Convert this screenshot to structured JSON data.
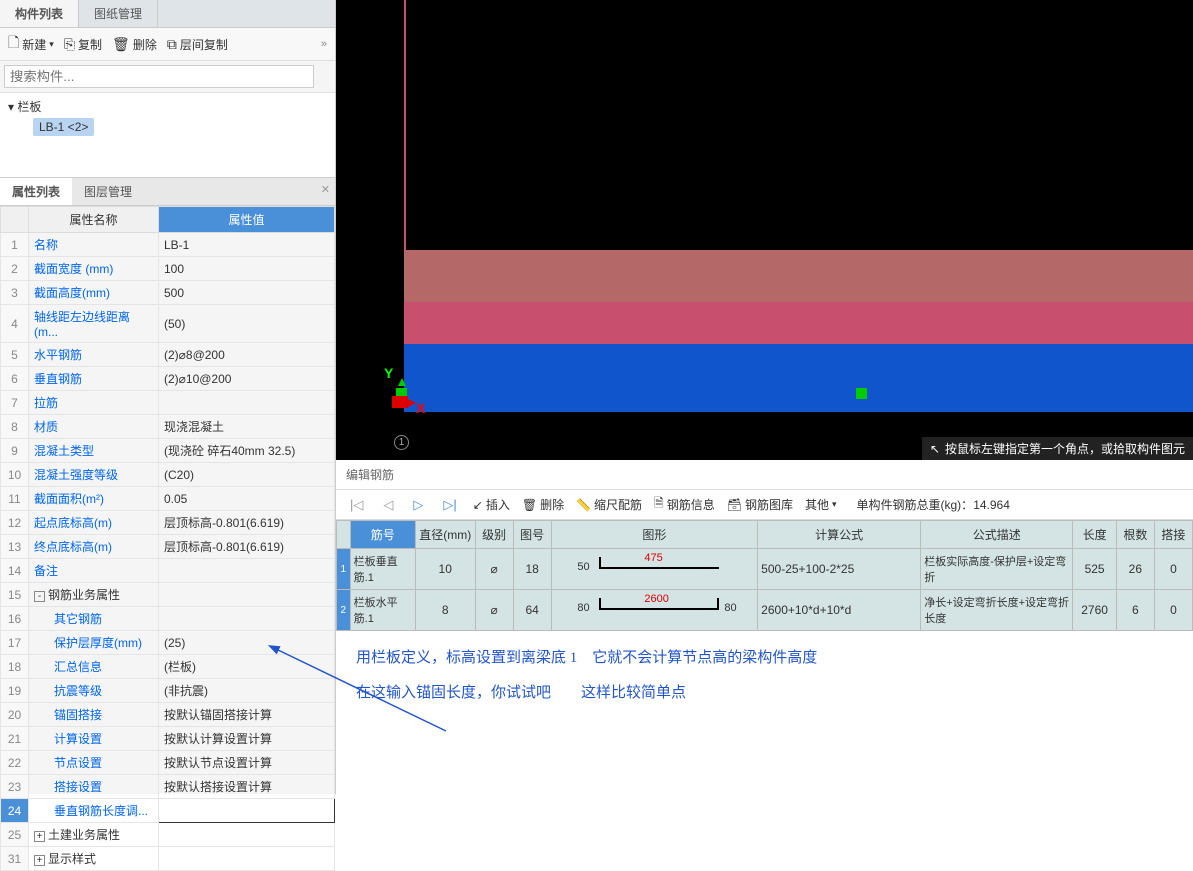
{
  "topTabs": {
    "active": "构件列表",
    "other": "图纸管理"
  },
  "toolbar": {
    "new": "新建",
    "copy": "复制",
    "delete": "删除",
    "levelCopy": "层间复制"
  },
  "search": {
    "placeholder": "搜索构件..."
  },
  "tree": {
    "root": "栏板",
    "item": "LB-1 <2>"
  },
  "propTabs": {
    "active": "属性列表",
    "other": "图层管理"
  },
  "propHeader": {
    "name": "属性名称",
    "value": "属性值"
  },
  "props": [
    {
      "n": "1",
      "name": "名称",
      "val": "LB-1",
      "blue": true
    },
    {
      "n": "2",
      "name": "截面宽度 (mm)",
      "val": "100",
      "blue": true
    },
    {
      "n": "3",
      "name": "截面高度(mm)",
      "val": "500",
      "blue": true
    },
    {
      "n": "4",
      "name": "轴线距左边线距离(m...",
      "val": "(50)",
      "blue": true
    },
    {
      "n": "5",
      "name": "水平钢筋",
      "val": "(2)⌀8@200",
      "blue": true
    },
    {
      "n": "6",
      "name": "垂直钢筋",
      "val": "(2)⌀10@200",
      "blue": true
    },
    {
      "n": "7",
      "name": "拉筋",
      "val": "",
      "blue": true
    },
    {
      "n": "8",
      "name": "材质",
      "val": "现浇混凝土",
      "blue": true
    },
    {
      "n": "9",
      "name": "混凝土类型",
      "val": "(现浇砼 碎石40mm 32.5)",
      "blue": true
    },
    {
      "n": "10",
      "name": "混凝土强度等级",
      "val": "(C20)",
      "blue": true
    },
    {
      "n": "11",
      "name": "截面面积(m²)",
      "val": "0.05",
      "blue": true
    },
    {
      "n": "12",
      "name": "起点底标高(m)",
      "val": "层顶标高-0.801(6.619)",
      "blue": true
    },
    {
      "n": "13",
      "name": "终点底标高(m)",
      "val": "层顶标高-0.801(6.619)",
      "blue": true
    },
    {
      "n": "14",
      "name": "备注",
      "val": "",
      "blue": true
    },
    {
      "n": "15",
      "name": "钢筋业务属性",
      "val": "",
      "exp": "-"
    },
    {
      "n": "16",
      "name": "其它钢筋",
      "val": "",
      "blue": true,
      "indent": true
    },
    {
      "n": "17",
      "name": "保护层厚度(mm)",
      "val": "(25)",
      "blue": true,
      "indent": true
    },
    {
      "n": "18",
      "name": "汇总信息",
      "val": "(栏板)",
      "blue": true,
      "indent": true
    },
    {
      "n": "19",
      "name": "抗震等级",
      "val": "(非抗震)",
      "blue": true,
      "indent": true
    },
    {
      "n": "20",
      "name": "锚固搭接",
      "val": "按默认锚固搭接计算",
      "blue": true,
      "indent": true
    },
    {
      "n": "21",
      "name": "计算设置",
      "val": "按默认计算设置计算",
      "blue": true,
      "indent": true
    },
    {
      "n": "22",
      "name": "节点设置",
      "val": "按默认节点设置计算",
      "blue": true,
      "indent": true
    },
    {
      "n": "23",
      "name": "搭接设置",
      "val": "按默认搭接设置计算",
      "blue": true,
      "indent": true
    },
    {
      "n": "24",
      "name": "垂直钢筋长度调...",
      "val": "",
      "blue": true,
      "indent": true,
      "highlight": true
    },
    {
      "n": "25",
      "name": "土建业务属性",
      "val": "",
      "exp": "+"
    },
    {
      "n": "31",
      "name": "显示样式",
      "val": "",
      "exp": "+"
    }
  ],
  "canvas": {
    "y": "Y",
    "x": "X",
    "num": "1"
  },
  "statusBar": "按鼠标左键指定第一个角点，或拾取构件图元",
  "rebarTitle": "编辑钢筋",
  "rebarToolbar": {
    "insert": "插入",
    "delete": "删除",
    "scale": "缩尺配筋",
    "info": "钢筋信息",
    "lib": "钢筋图库",
    "other": "其他",
    "weightLabel": "单构件钢筋总重(kg)：",
    "weight": "14.964"
  },
  "rebarHeader": {
    "num": "筋号",
    "dia": "直径(mm)",
    "grade": "级别",
    "symbol": "图号",
    "shape": "图形",
    "formula": "计算公式",
    "desc": "公式描述",
    "len": "长度",
    "count": "根数",
    "lap": "搭接"
  },
  "rebarRows": [
    {
      "rn": "1",
      "name": "栏板垂直筋.1",
      "dia": "10",
      "grade": "⌀",
      "sym": "18",
      "l": "50",
      "mid": "475",
      "r": "",
      "formula": "500-25+100-2*25",
      "desc": "栏板实际高度-保护层+设定弯折",
      "len": "525",
      "count": "26",
      "lap": "0"
    },
    {
      "rn": "2",
      "name": "栏板水平筋.1",
      "dia": "8",
      "grade": "⌀",
      "sym": "64",
      "l": "80",
      "mid": "2600",
      "r": "80",
      "formula": "2600+10*d+10*d",
      "desc": "净长+设定弯折长度+设定弯折长度",
      "len": "2760",
      "count": "6",
      "lap": "0"
    }
  ],
  "annotations": {
    "line1a": "用栏板定义，标高设置到离梁底 1",
    "line1b": "它就不会计算节点高的梁构件高度",
    "line2a": "在这输入锚固长度，你试试吧",
    "line2b": "这样比较简单点"
  }
}
